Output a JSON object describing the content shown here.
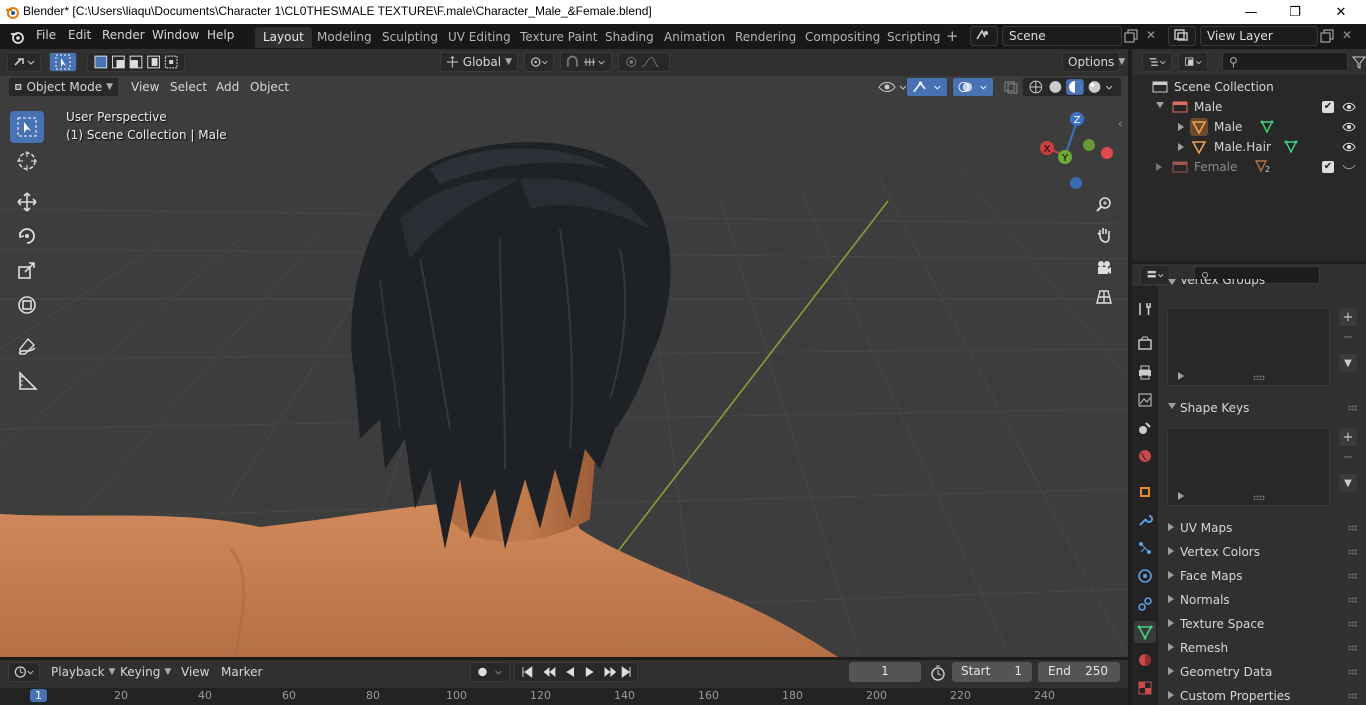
{
  "window": {
    "title": "Blender* [C:\\Users\\liaqu\\Documents\\Character 1\\CL0THES\\MALE TEXTURE\\F.male\\Character_Male_&Female.blend]",
    "min_glyph": "—",
    "max_glyph": "❐",
    "close_glyph": "✕"
  },
  "menu": [
    "File",
    "Edit",
    "Render",
    "Window",
    "Help"
  ],
  "workspaces": [
    "Layout",
    "Modeling",
    "Sculpting",
    "UV Editing",
    "Texture Paint",
    "Shading",
    "Animation",
    "Rendering",
    "Compositing",
    "Scripting"
  ],
  "workspace_add": "+",
  "scene": {
    "name": "Scene",
    "view_layer": "View Layer"
  },
  "viewport": {
    "transform_orientation": "Global",
    "options_label": "Options",
    "mode": "Object Mode",
    "header_menus": [
      "View",
      "Select",
      "Add",
      "Object"
    ],
    "perspective_label": "User Perspective",
    "collection_label": "(1) Scene Collection | Male",
    "gizmo_axes": {
      "z": "Z",
      "y": "Y",
      "x": "X"
    },
    "colors": {
      "background": "#3d3d3d",
      "grid": "#4a4a4a",
      "y_axis": "#7fa23b",
      "skin": "#c98256",
      "hair": "#1e2126",
      "accent": "#4772b3"
    }
  },
  "outliner": {
    "root": "Scene Collection",
    "items": [
      {
        "label": "Male",
        "kind": "collection"
      },
      {
        "label": "Male",
        "kind": "object"
      },
      {
        "label": "Male.Hair",
        "kind": "object"
      },
      {
        "label": "Female",
        "kind": "collection",
        "badge": "2"
      }
    ]
  },
  "properties": {
    "panels": [
      {
        "label": "Vertex Groups",
        "expanded": true
      },
      {
        "label": "Shape Keys",
        "expanded": true
      },
      {
        "label": "UV Maps",
        "expanded": false
      },
      {
        "label": "Vertex Colors",
        "expanded": false
      },
      {
        "label": "Face Maps",
        "expanded": false
      },
      {
        "label": "Normals",
        "expanded": false
      },
      {
        "label": "Texture Space",
        "expanded": false
      },
      {
        "label": "Remesh",
        "expanded": false
      },
      {
        "label": "Geometry Data",
        "expanded": false
      },
      {
        "label": "Custom Properties",
        "expanded": false
      }
    ]
  },
  "timeline": {
    "menus": [
      "Playback",
      "Keying",
      "View",
      "Marker"
    ],
    "current_frame": "1",
    "start_label": "Start",
    "start": "1",
    "end_label": "End",
    "end": "250",
    "ruler_ticks": [
      "1",
      "20",
      "40",
      "60",
      "80",
      "100",
      "120",
      "140",
      "160",
      "180",
      "200",
      "220",
      "240"
    ]
  }
}
